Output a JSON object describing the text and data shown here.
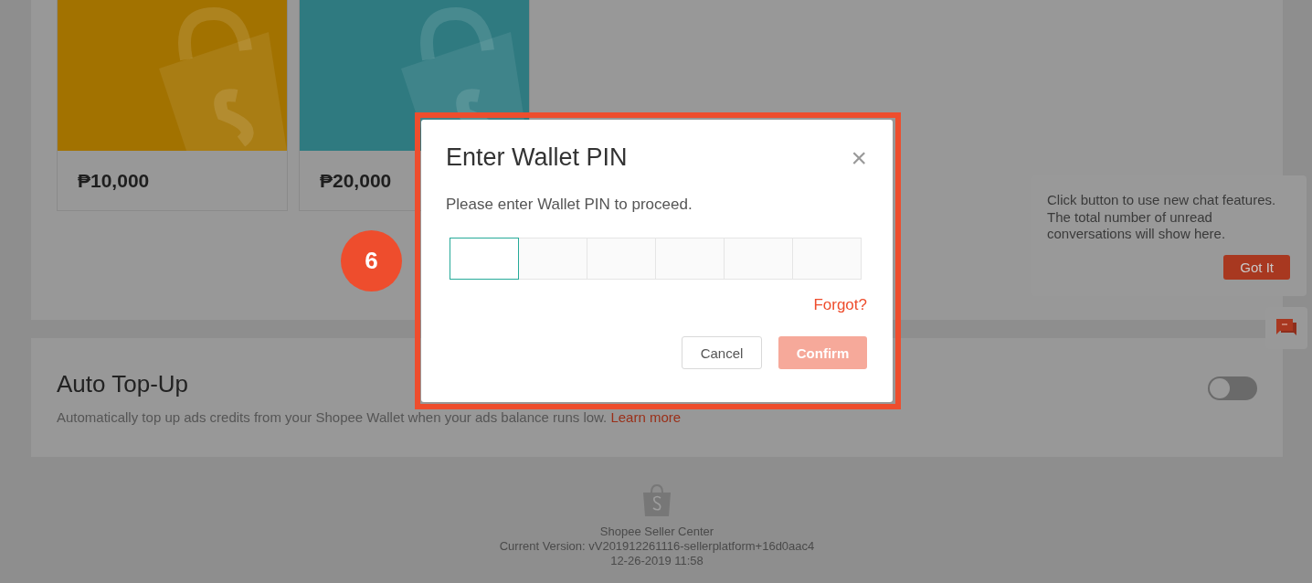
{
  "credit_cards": [
    {
      "price": "₱10,000",
      "color": "#a27200"
    },
    {
      "price": "₱20,000",
      "color": "#2f7a80"
    }
  ],
  "auto_top_up": {
    "title": "Auto Top-Up",
    "description": "Automatically top up ads credits from your Shopee Wallet when your ads balance runs low.",
    "link": "Learn more",
    "on": false
  },
  "footer": {
    "name": "Shopee Seller Center",
    "version": "Current Version: vV201912261116-sellerplatform+16d0aac4",
    "date": "12-26-2019 11:58"
  },
  "step_badge": "6",
  "modal": {
    "title": "Enter Wallet PIN",
    "close": "×",
    "message": "Please enter Wallet PIN to proceed.",
    "pin_boxes": [
      {
        "selected": true
      },
      {
        "selected": false
      },
      {
        "selected": false
      },
      {
        "selected": false
      },
      {
        "selected": false
      },
      {
        "selected": false
      }
    ],
    "forgot": "Forgot?",
    "cancel": "Cancel",
    "confirm": {
      "label": "Confirm",
      "disabled": true
    }
  },
  "chat_tip": {
    "message": "Click button to use new chat features. The total number of unread conversations will show here.",
    "button": "Got It"
  }
}
